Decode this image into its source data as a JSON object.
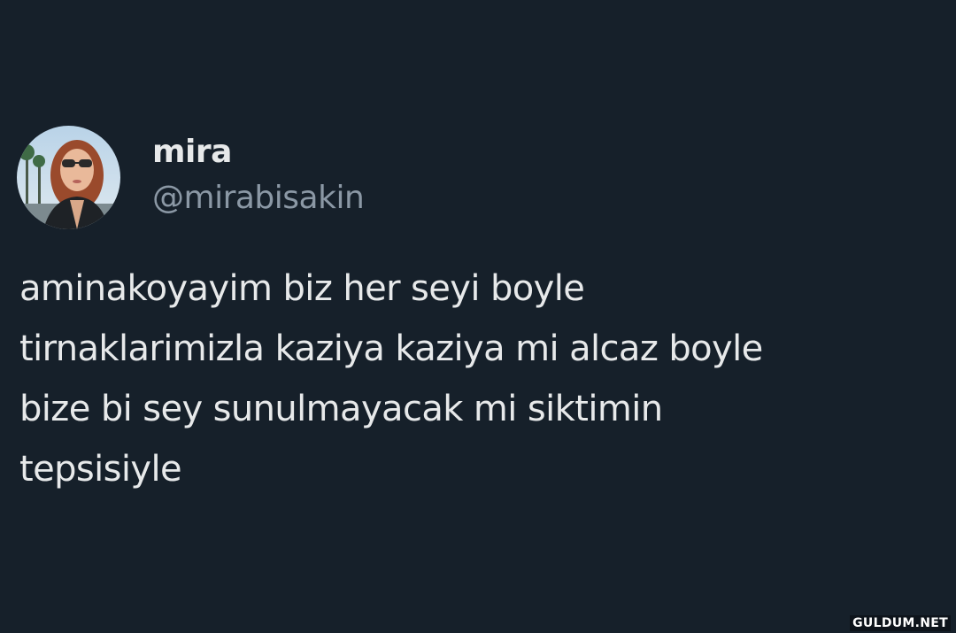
{
  "author": {
    "display_name": "mira",
    "handle": "@mirabisakin",
    "avatar_icon": "profile-photo"
  },
  "tweet": {
    "lines": [
      "aminakoyayim biz her seyi boyle",
      "tirnaklarimizla kaziya kaziya mi alcaz boyle",
      "bize bi sey sunulmayacak mi siktimin",
      "tepsisiyle"
    ]
  },
  "watermark": "GULDUM.NET",
  "colors": {
    "background": "#16202a",
    "text_primary": "#e7e9ea",
    "text_secondary": "#8b98a5"
  }
}
